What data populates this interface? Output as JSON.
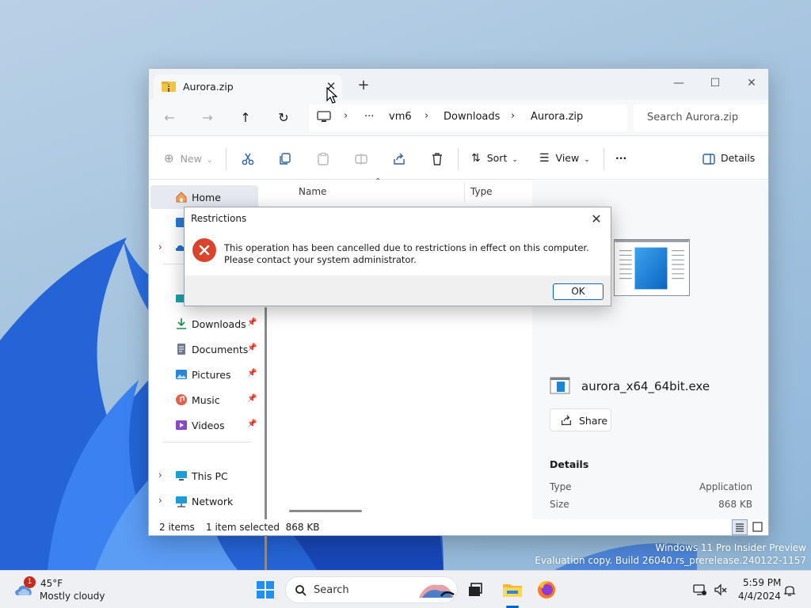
{
  "window": {
    "tab_title": "Aurora.zip",
    "address": {
      "crumbs": [
        "vm6",
        "Downloads",
        "Aurora.zip"
      ],
      "ellipsis": "···"
    },
    "search_placeholder": "Search Aurora.zip"
  },
  "toolbar": {
    "new_label": "New",
    "sort_label": "Sort",
    "view_label": "View",
    "more_label": "···",
    "details_label": "Details"
  },
  "nav": {
    "home": "Home",
    "downloads": "Downloads",
    "documents": "Documents",
    "pictures": "Pictures",
    "music": "Music",
    "videos": "Videos",
    "this_pc": "This PC",
    "network": "Network"
  },
  "columns": {
    "name": "Name",
    "type": "Type"
  },
  "details": {
    "filename": "aurora_x64_64bit.exe",
    "share_label": "Share",
    "heading": "Details",
    "rows": [
      {
        "key": "Type",
        "value": "Application"
      },
      {
        "key": "Size",
        "value": "868 KB"
      }
    ]
  },
  "status": {
    "items": "2 items",
    "selected": "1 item selected  868 KB"
  },
  "dialog": {
    "title": "Restrictions",
    "message": "This operation has been cancelled due to restrictions in effect on this computer. Please contact your system administrator.",
    "ok_label": "OK"
  },
  "watermark": {
    "line1": "Windows 11 Pro Insider Preview",
    "line2": "Evaluation copy. Build 26040.rs_prerelease.240122-1157"
  },
  "taskbar": {
    "weather_badge": "1",
    "temperature": "45°F",
    "condition": "Mostly cloudy",
    "search_label": "Search",
    "time": "5:59 PM",
    "date": "4/4/2024"
  },
  "colors": {
    "accent": "#0067c0",
    "error": "#d9442c",
    "badge": "#c42b1c"
  }
}
